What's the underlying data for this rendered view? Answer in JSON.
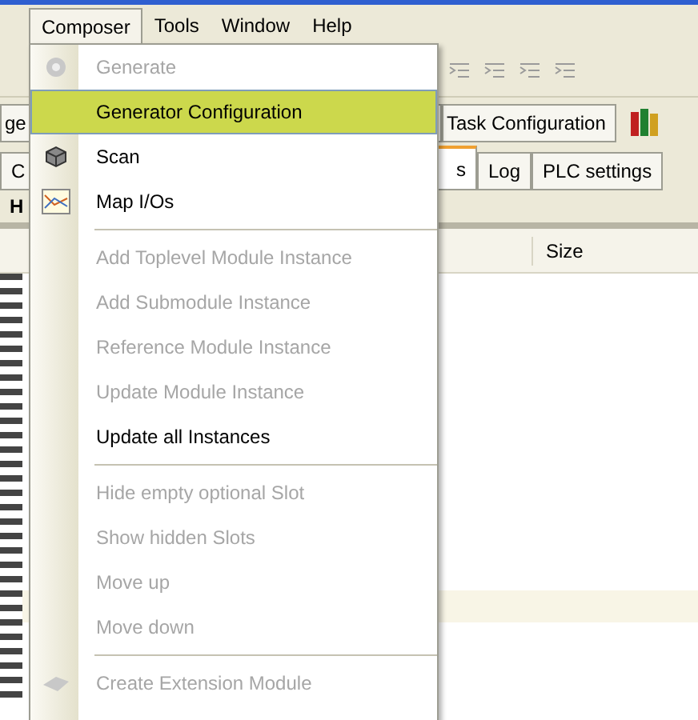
{
  "menubar": [
    {
      "label": "Composer",
      "selected": true
    },
    {
      "label": "Tools",
      "selected": false
    },
    {
      "label": "Window",
      "selected": false
    },
    {
      "label": "Help",
      "selected": false
    }
  ],
  "tabs_top": [
    {
      "label": "ge",
      "selected": false
    },
    {
      "label": "Task Configuration",
      "selected": false
    }
  ],
  "tabs_bottom": [
    {
      "label": "C",
      "selected": false
    },
    {
      "label": "s",
      "selected": true
    },
    {
      "label": "Log",
      "selected": false
    },
    {
      "label": "PLC settings",
      "selected": false
    }
  ],
  "panel_label": "H",
  "table": {
    "columns": [
      "Size"
    ]
  },
  "menu": {
    "items": [
      {
        "kind": "item",
        "label": "Generate",
        "disabled": true,
        "selected": false
      },
      {
        "kind": "item",
        "label": "Generator Configuration",
        "disabled": false,
        "selected": true
      },
      {
        "kind": "item",
        "label": "Scan",
        "disabled": false,
        "selected": false
      },
      {
        "kind": "item",
        "label": "Map I/Os",
        "disabled": false,
        "selected": false
      },
      {
        "kind": "separator"
      },
      {
        "kind": "item",
        "label": "Add Toplevel Module Instance",
        "disabled": true,
        "selected": false
      },
      {
        "kind": "item",
        "label": "Add Submodule Instance",
        "disabled": true,
        "selected": false
      },
      {
        "kind": "item",
        "label": "Reference Module Instance",
        "disabled": true,
        "selected": false
      },
      {
        "kind": "item",
        "label": "Update Module Instance",
        "disabled": true,
        "selected": false
      },
      {
        "kind": "item",
        "label": "Update all Instances",
        "disabled": false,
        "selected": false
      },
      {
        "kind": "separator"
      },
      {
        "kind": "item",
        "label": "Hide empty optional Slot",
        "disabled": true,
        "selected": false
      },
      {
        "kind": "item",
        "label": "Show hidden Slots",
        "disabled": true,
        "selected": false
      },
      {
        "kind": "item",
        "label": "Move up",
        "disabled": true,
        "selected": false
      },
      {
        "kind": "item",
        "label": "Move down",
        "disabled": true,
        "selected": false
      },
      {
        "kind": "separator"
      },
      {
        "kind": "item",
        "label": "Create Extension Module",
        "disabled": true,
        "selected": false
      }
    ]
  }
}
